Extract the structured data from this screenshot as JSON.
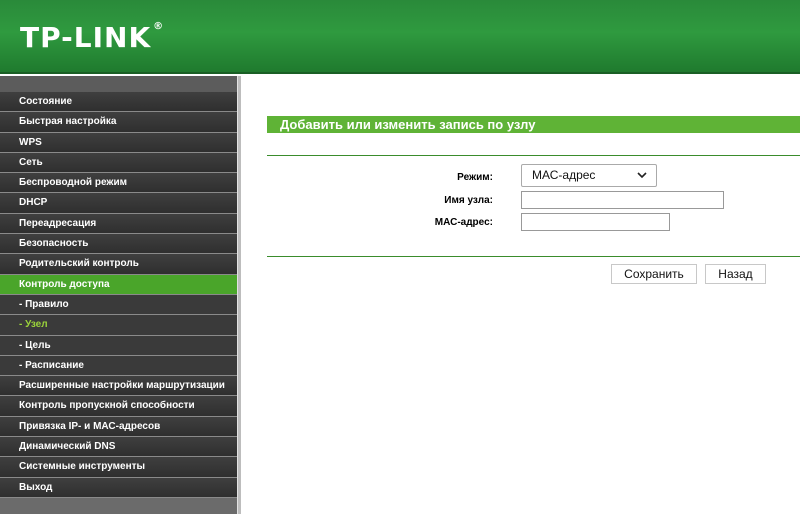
{
  "header": {
    "logo": "TP-LINK",
    "logo_mark": "®"
  },
  "sidebar": {
    "items": [
      {
        "label": "Состояние"
      },
      {
        "label": "Быстрая настройка"
      },
      {
        "label": "WPS"
      },
      {
        "label": "Сеть"
      },
      {
        "label": "Беспроводной режим"
      },
      {
        "label": "DHCP"
      },
      {
        "label": "Переадресация"
      },
      {
        "label": "Безопасность"
      },
      {
        "label": "Родительский контроль"
      },
      {
        "label": "Контроль доступа"
      },
      {
        "label": "- Правило"
      },
      {
        "label": "- Узел"
      },
      {
        "label": "- Цель"
      },
      {
        "label": "- Расписание"
      },
      {
        "label": "Расширенные настройки маршрутизации"
      },
      {
        "label": "Контроль пропускной способности"
      },
      {
        "label": "Привязка IP- и МАС-адресов"
      },
      {
        "label": "Динамический DNS"
      },
      {
        "label": "Системные инструменты"
      },
      {
        "label": "Выход"
      }
    ]
  },
  "main": {
    "title": "Добавить или изменить запись по узлу",
    "form": {
      "mode_label": "Режим:",
      "mode_value": "МАС-адрес",
      "host_label": "Имя узла:",
      "host_value": "",
      "mac_label": "МАС-адрес:",
      "mac_value": ""
    },
    "buttons": {
      "save": "Сохранить",
      "back": "Назад"
    }
  },
  "colors": {
    "header_green": "#2f9a3f",
    "accent_green": "#5fb336",
    "menu_dark": "#333333",
    "active_sub_text": "#9bd43a"
  }
}
